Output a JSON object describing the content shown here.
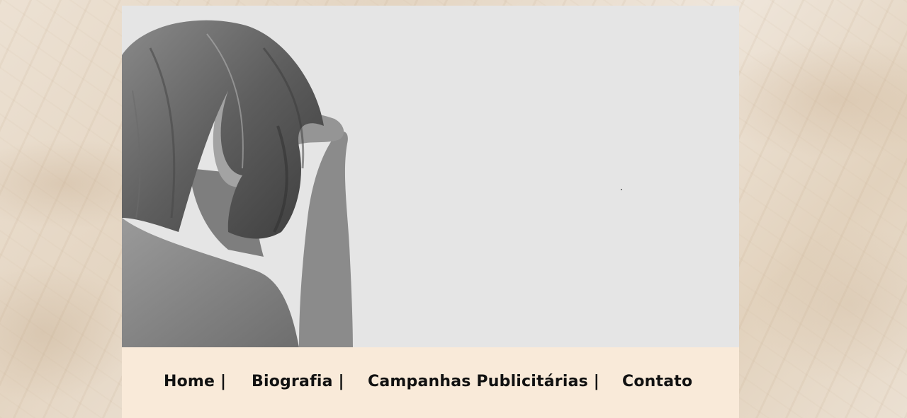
{
  "hero": {
    "photo_icon": "portrait-photo-grayscale",
    "background_color": "#e5e5e5"
  },
  "nav": {
    "background_color": "#f9ead9",
    "items": [
      {
        "label": "Home |"
      },
      {
        "label": "Biografia |"
      },
      {
        "label": "Campanhas Publicitárias |"
      },
      {
        "label": "Contato"
      }
    ]
  }
}
